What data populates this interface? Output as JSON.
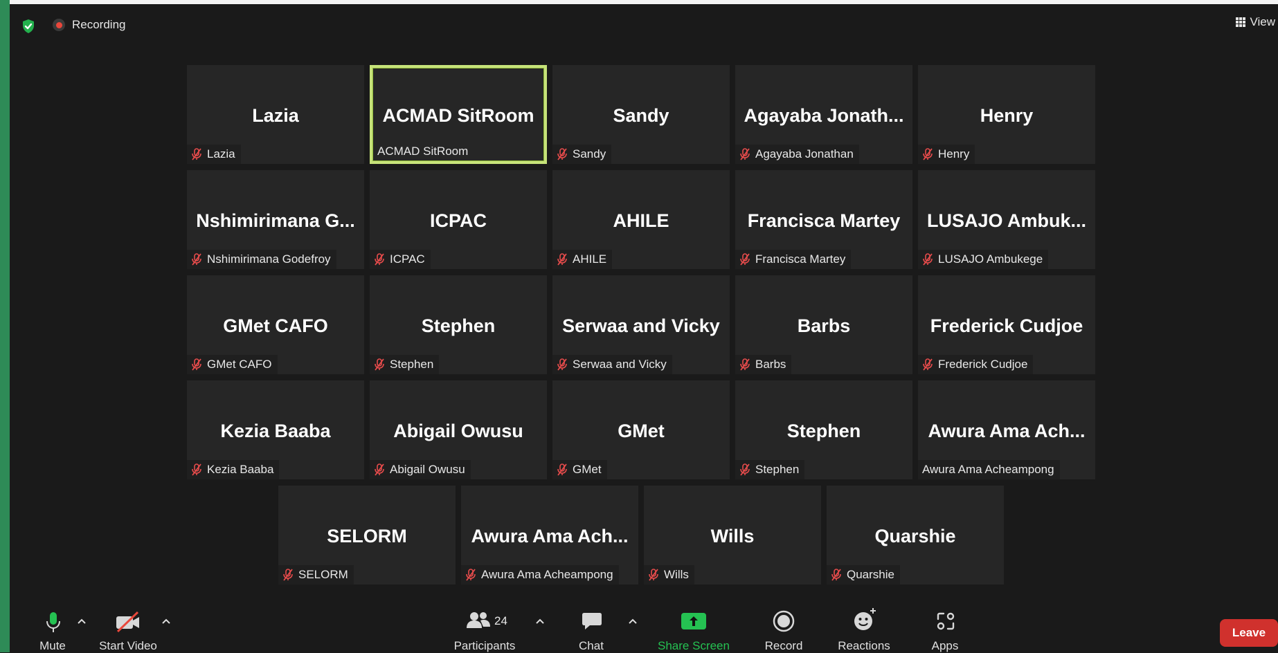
{
  "top": {
    "recording_label": "Recording",
    "view_label": "View"
  },
  "participants": [
    {
      "big": "Lazia",
      "label": "Lazia",
      "muted": true
    },
    {
      "big": "ACMAD SitRoom",
      "label": "ACMAD SitRoom",
      "muted": false,
      "active": true
    },
    {
      "big": "Sandy",
      "label": "Sandy",
      "muted": true
    },
    {
      "big": "Agayaba  Jonath...",
      "label": "Agayaba Jonathan",
      "muted": true
    },
    {
      "big": "Henry",
      "label": "Henry",
      "muted": true
    },
    {
      "big": "Nshimirimana  G...",
      "label": "Nshimirimana Godefroy",
      "muted": true
    },
    {
      "big": "ICPAC",
      "label": "ICPAC",
      "muted": true
    },
    {
      "big": "AHILE",
      "label": "AHILE",
      "muted": true
    },
    {
      "big": "Francisca Martey",
      "label": "Francisca Martey",
      "muted": true
    },
    {
      "big": "LUSAJO  Ambuk...",
      "label": "LUSAJO Ambukege",
      "muted": true
    },
    {
      "big": "GMet CAFO",
      "label": "GMet CAFO",
      "muted": true
    },
    {
      "big": "Stephen",
      "label": "Stephen",
      "muted": true
    },
    {
      "big": "Serwaa and Vicky",
      "label": "Serwaa and Vicky",
      "muted": true
    },
    {
      "big": "Barbs",
      "label": "Barbs",
      "muted": true
    },
    {
      "big": "Frederick Cudjoe",
      "label": "Frederick Cudjoe",
      "muted": true
    },
    {
      "big": "Kezia Baaba",
      "label": "Kezia Baaba",
      "muted": true
    },
    {
      "big": "Abigail Owusu",
      "label": "Abigail Owusu",
      "muted": true
    },
    {
      "big": "GMet",
      "label": "GMet",
      "muted": true
    },
    {
      "big": "Stephen",
      "label": "Stephen",
      "muted": true
    },
    {
      "big": "Awura Ama Ach...",
      "label": "Awura Ama Acheampong",
      "muted": false
    },
    {
      "big": "SELORM",
      "label": "SELORM",
      "muted": true
    },
    {
      "big": "Awura Ama Ach...",
      "label": "Awura Ama Acheampong",
      "muted": true
    },
    {
      "big": "Wills",
      "label": "Wills",
      "muted": true
    },
    {
      "big": "Quarshie",
      "label": "Quarshie",
      "muted": true
    }
  ],
  "toolbar": {
    "mute": "Mute",
    "start_video": "Start Video",
    "participants": "Participants",
    "participants_count": "24",
    "chat": "Chat",
    "share_screen": "Share Screen",
    "record": "Record",
    "reactions": "Reactions",
    "apps": "Apps",
    "leave": "Leave"
  },
  "colors": {
    "share_green": "#25c152",
    "leave_red": "#d0312d",
    "active_border": "#c6e27a"
  }
}
